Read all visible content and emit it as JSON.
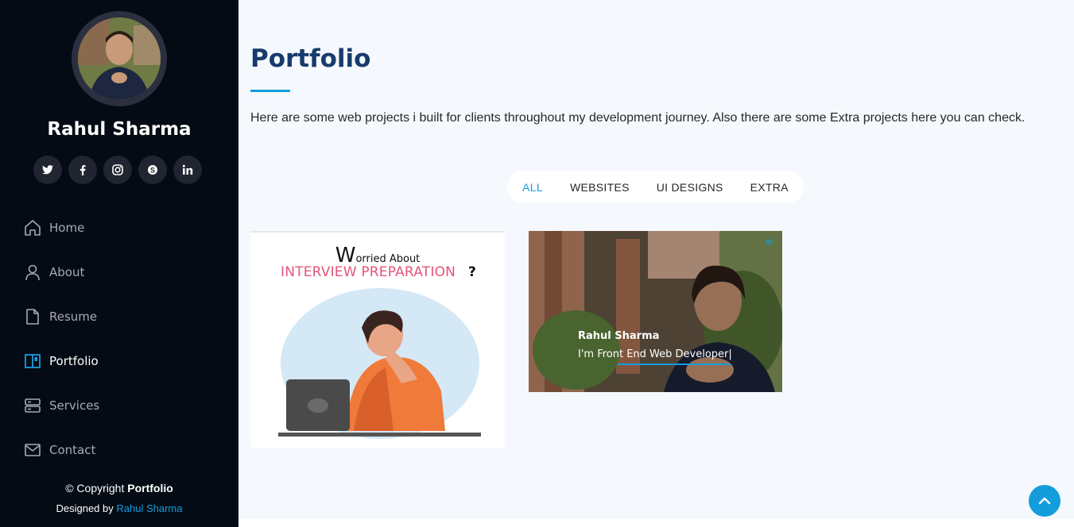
{
  "sidebar": {
    "profile_name": "Rahul Sharma",
    "socials": [
      {
        "icon": "twitter-icon",
        "glyph": "t"
      },
      {
        "icon": "facebook-icon",
        "glyph": "f"
      },
      {
        "icon": "instagram-icon",
        "glyph": "◎"
      },
      {
        "icon": "skype-icon",
        "glyph": "S"
      },
      {
        "icon": "linkedin-icon",
        "glyph": "in"
      }
    ],
    "nav": [
      {
        "label": "Home",
        "icon": "home-icon"
      },
      {
        "label": "About",
        "icon": "user-icon"
      },
      {
        "label": "Resume",
        "icon": "file-icon"
      },
      {
        "label": "Portfolio",
        "icon": "book-icon",
        "active": true
      },
      {
        "label": "Services",
        "icon": "server-icon"
      },
      {
        "label": "Contact",
        "icon": "envelope-icon"
      }
    ],
    "copyright_prefix": "© Copyright",
    "copyright_bold": "Portfolio",
    "designed_prefix": "Designed by",
    "designed_link": "Rahul Sharma"
  },
  "main": {
    "title": "Portfolio",
    "description": "Here are some web projects i built for clients throughout my development journey. Also there are some Extra projects here you can check.",
    "filters": [
      "ALL",
      "WEBSITES",
      "UI DESIGNS",
      "EXTRA"
    ],
    "active_filter": "ALL",
    "cards": [
      {
        "line1_big": "W",
        "line1_rest": "orried About",
        "line2": "INTERVIEW PREPARATION",
        "line2_suffix": "?"
      },
      {
        "name": "Rahul Sharma",
        "role": "I'm Front End Web Developer|"
      }
    ]
  },
  "colors": {
    "sidebar_bg": "#040b14",
    "accent": "#149ddd",
    "title": "#173b6c",
    "main_bg": "#f5f8fd"
  }
}
